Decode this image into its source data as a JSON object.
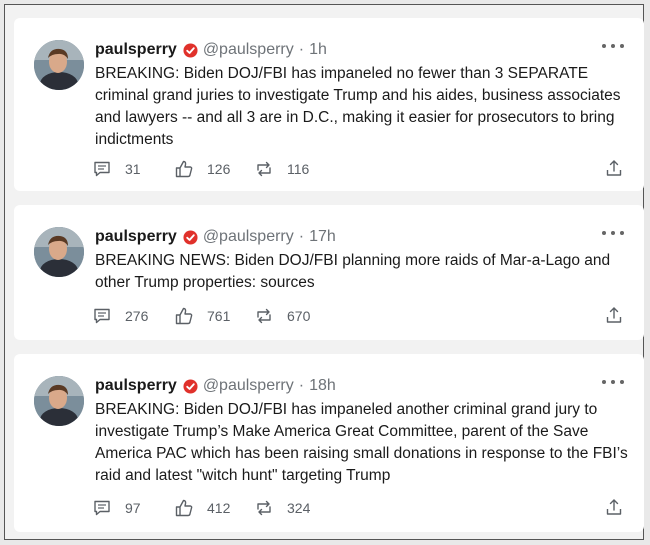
{
  "tweets": [
    {
      "username": "paulsperry",
      "handle": "@paulsperry",
      "separator": "·",
      "time": "1h",
      "text": "BREAKING: Biden DOJ/FBI has impaneled no fewer than 3 SEPARATE criminal grand juries to investigate Trump and his aides, business associates and lawyers -- and all 3 are in D.C., making it easier for prosecutors to bring indictments",
      "replies": "31",
      "likes": "126",
      "reposts": "116"
    },
    {
      "username": "paulsperry",
      "handle": "@paulsperry",
      "separator": "·",
      "time": "17h",
      "text": "BREAKING NEWS: Biden DOJ/FBI planning more raids of Mar-a-Lago and other Trump properties: sources",
      "replies": "276",
      "likes": "761",
      "reposts": "670"
    },
    {
      "username": "paulsperry",
      "handle": "@paulsperry",
      "separator": "·",
      "time": "18h",
      "text": "BREAKING: Biden DOJ/FBI has impaneled another criminal grand jury to investigate Trump’s Make America Great Committee, parent of the Save America PAC which has been raising small donations in response to the FBI’s raid and latest \"witch hunt\" targeting Trump",
      "replies": "97",
      "likes": "412",
      "reposts": "324"
    }
  ],
  "icons": {
    "badge": "red-verified-badge-icon",
    "more": "more-dots-icon",
    "reply": "comment-icon",
    "like": "thumbs-up-icon",
    "repost": "repost-icon",
    "share": "share-icon"
  },
  "colors": {
    "badge": "#e0312b",
    "meta_text": "#6e7378",
    "action_icon": "#5b6066"
  }
}
